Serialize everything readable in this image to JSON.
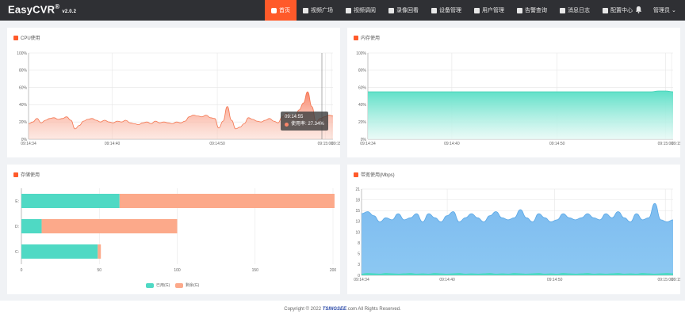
{
  "header": {
    "brand": "EasyCVR",
    "reg": "®",
    "version": "v2.0.2",
    "nav": [
      {
        "label": "首页",
        "icon": "home-icon",
        "active": true
      },
      {
        "label": "视频广场",
        "icon": "play-circle-icon",
        "active": false
      },
      {
        "label": "视频调阅",
        "icon": "video-grid-icon",
        "active": false
      },
      {
        "label": "录像回看",
        "icon": "camera-icon",
        "active": false
      },
      {
        "label": "设备管理",
        "icon": "device-list-icon",
        "active": false
      },
      {
        "label": "用户管理",
        "icon": "user-icon",
        "active": false
      },
      {
        "label": "告警查询",
        "icon": "alarm-icon",
        "active": false
      },
      {
        "label": "消息日志",
        "icon": "bell-log-icon",
        "active": false
      },
      {
        "label": "配置中心",
        "icon": "gear-icon",
        "active": false
      }
    ],
    "admin": "管理员 ⌄"
  },
  "colors": {
    "accent": "#ff5a2a",
    "cpu": "#f9866a",
    "memory": "#5fe0c8",
    "used": "#4fd9c4",
    "remaining": "#fca98a",
    "bandwidth": "#85c3ef"
  },
  "panels": {
    "cpu": {
      "title": "CPU使用"
    },
    "memory": {
      "title": "内存使用"
    },
    "storage": {
      "title": "存储使用"
    },
    "bandwidth": {
      "title": "带宽使用(Mbps)"
    }
  },
  "tooltip": {
    "time": "09:14:55",
    "text": "使用率: 27.34%"
  },
  "footer": {
    "prefix": "Copyright © 2022 ",
    "brand": "TSINGSEE",
    "suffix": ".com All Rights Reserved."
  },
  "chart_data": [
    {
      "id": "cpu",
      "type": "area",
      "ylim": [
        0,
        100
      ],
      "yticks": [
        "0%",
        "20%",
        "40%",
        "60%",
        "80%",
        "100%"
      ],
      "xticks": [
        "09:14:34",
        "09:14:40",
        "09:14:50",
        "09:15:00",
        "09:15:0"
      ],
      "values": [
        18,
        20,
        24,
        19,
        22,
        24,
        25,
        23,
        24,
        26,
        22,
        12,
        16,
        21,
        23,
        24,
        22,
        20,
        22,
        20,
        19,
        21,
        20,
        22,
        19,
        18,
        17,
        19,
        20,
        18,
        21,
        19,
        20,
        19,
        18,
        20,
        19,
        21,
        26,
        28,
        27,
        26,
        28,
        25,
        24,
        13,
        21,
        38,
        22,
        12,
        14,
        18,
        25,
        23,
        21,
        20,
        22,
        24,
        21,
        19,
        26,
        30,
        28,
        27,
        34,
        42,
        55,
        38,
        20,
        24,
        26,
        28,
        27
      ]
    },
    {
      "id": "memory",
      "type": "area",
      "ylim": [
        0,
        100
      ],
      "yticks": [
        "0%",
        "20%",
        "40%",
        "60%",
        "80%",
        "100%"
      ],
      "xticks": [
        "09:14:34",
        "09:14:40",
        "09:14:50",
        "09:15:00",
        "09:15:0"
      ],
      "values": [
        55,
        55,
        55,
        55,
        55,
        55,
        55,
        55,
        55,
        55,
        55,
        55,
        55,
        55,
        55,
        55,
        55,
        55,
        55,
        55,
        55,
        55,
        55,
        55,
        55,
        55,
        55,
        55,
        55,
        55,
        55,
        55,
        55,
        55,
        55,
        55,
        55,
        55,
        55,
        55,
        56,
        56,
        55
      ]
    },
    {
      "id": "storage",
      "type": "bar",
      "orientation": "horizontal",
      "stacked": true,
      "categories": [
        "E:",
        "D:",
        "C:"
      ],
      "xlim": [
        0,
        200
      ],
      "xticks": [
        "0",
        "50",
        "100",
        "150",
        "200"
      ],
      "series": [
        {
          "name": "已用(G)",
          "values": [
            63,
            13,
            49
          ]
        },
        {
          "name": "剩余(G)",
          "values": [
            138,
            87,
            2
          ]
        }
      ]
    },
    {
      "id": "bandwidth",
      "type": "area",
      "ylim": [
        0,
        21
      ],
      "yticks": [
        "0",
        "3",
        "5",
        "8",
        "10",
        "13",
        "15",
        "18",
        "21"
      ],
      "xticks": [
        "09:14:34",
        "09:14:40",
        "09:14:50",
        "09:15:00",
        "09:15:0"
      ],
      "series": [
        {
          "values": [
            15,
            15.5,
            14.5,
            13,
            14,
            13.5,
            15,
            13.5,
            14,
            15,
            13,
            15,
            14,
            13,
            14.5,
            15.5,
            13,
            14,
            15,
            14,
            13,
            14.5,
            15.5,
            14,
            13.5,
            14,
            16,
            14,
            13,
            15,
            14,
            13,
            13.5,
            15,
            14,
            13.5,
            14,
            15,
            14,
            13.5,
            15,
            14,
            15.5,
            14,
            13,
            15,
            13.5,
            14,
            17.5,
            13.5,
            13,
            13.5
          ]
        },
        {
          "values": [
            0.3,
            0.5,
            0.4,
            0.3,
            0.5,
            0.4,
            0.3,
            0.4,
            0.5,
            0.3,
            0.4,
            0.3,
            0.5,
            0.4,
            0.3,
            0.4,
            0.5,
            0.3,
            0.4,
            0.3,
            0.4,
            0.5,
            0.3,
            0.4,
            0.3,
            0.5,
            0.4,
            0.3,
            0.4,
            0.5,
            0.3,
            0.4,
            0.3,
            0.5,
            0.4,
            0.3,
            0.4,
            0.5,
            0.3,
            0.4,
            0.3,
            0.4,
            0.5,
            0.3,
            0.4,
            0.3,
            0.5,
            0.4,
            0.3,
            0.4,
            0.5,
            0.4
          ]
        }
      ]
    }
  ]
}
